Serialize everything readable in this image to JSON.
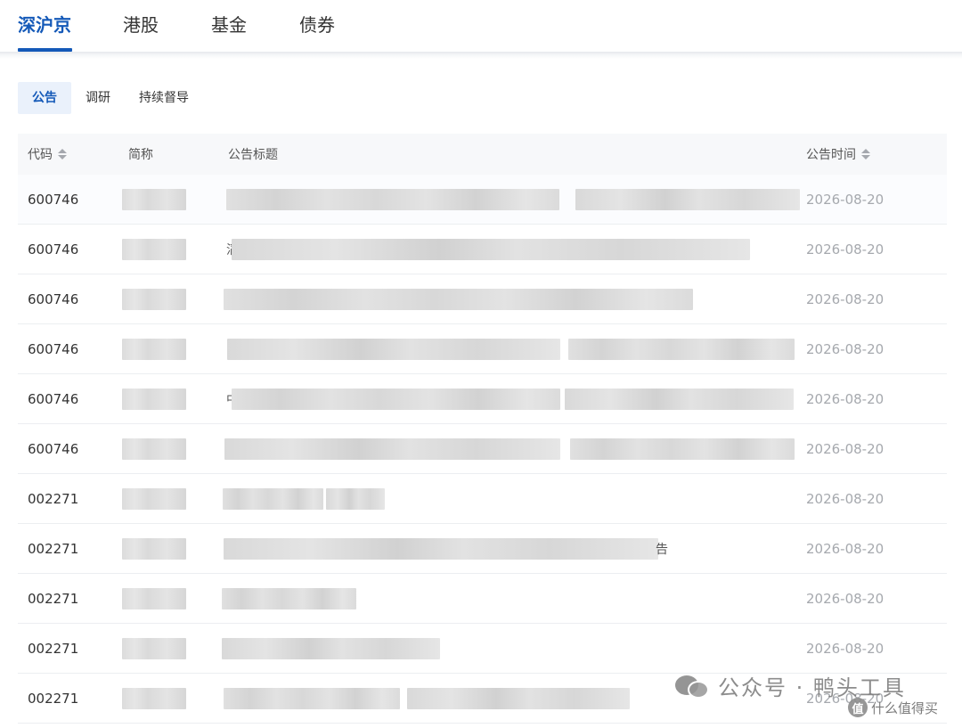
{
  "top_tabs": [
    {
      "label": "深沪京",
      "active": true
    },
    {
      "label": "港股",
      "active": false
    },
    {
      "label": "基金",
      "active": false
    },
    {
      "label": "债券",
      "active": false
    }
  ],
  "sub_tabs": [
    {
      "label": "公告",
      "active": true
    },
    {
      "label": "调研",
      "active": false
    },
    {
      "label": "持续督导",
      "active": false
    }
  ],
  "table": {
    "headers": {
      "code": "代码",
      "name": "简称",
      "title": "公告标题",
      "time": "公告时间"
    },
    "rows": [
      {
        "code": "600746",
        "date": "2026-08-20"
      },
      {
        "code": "600746",
        "date": "2026-08-20"
      },
      {
        "code": "600746",
        "date": "2026-08-20"
      },
      {
        "code": "600746",
        "date": "2026-08-20"
      },
      {
        "code": "600746",
        "date": "2026-08-20"
      },
      {
        "code": "600746",
        "date": "2026-08-20"
      },
      {
        "code": "002271",
        "date": "2026-08-20"
      },
      {
        "code": "002271",
        "date": "2026-08-20"
      },
      {
        "code": "002271",
        "date": "2026-08-20"
      },
      {
        "code": "002271",
        "date": "2026-08-20"
      },
      {
        "code": "002271",
        "date": "2026-08-20"
      }
    ],
    "visible_fragments": {
      "row2_title_start": "滔",
      "row5_title_start": "中",
      "row8_title_end": "告"
    }
  },
  "watermark": {
    "main": "公众号 · 鸭头工具",
    "secondary": "什么值得买",
    "secondary_badge": "值"
  }
}
